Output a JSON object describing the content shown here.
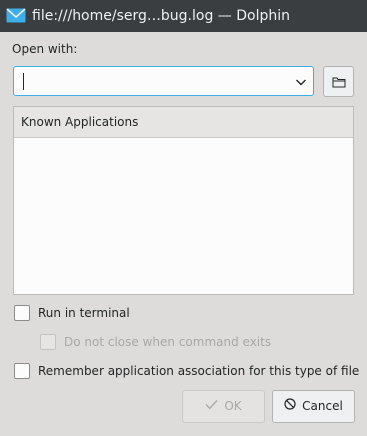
{
  "window": {
    "title": "file:///home/serg…bug.log — Dolphin",
    "icon": "mail-envelope-icon"
  },
  "dialog": {
    "open_with_label": "Open with:",
    "command_input": {
      "value": "",
      "placeholder": ""
    },
    "known_apps_header": "Known Applications",
    "known_apps": [],
    "run_in_terminal": {
      "label": "Run in terminal",
      "checked": false
    },
    "do_not_close": {
      "label": "Do not close when command exits",
      "checked": false,
      "enabled": false
    },
    "remember": {
      "label": "Remember application association for this type of file",
      "checked": false
    },
    "ok_label": "OK",
    "cancel_label": "Cancel"
  },
  "colors": {
    "titlebar": "#3b3e41",
    "background": "#dedcda",
    "focus": "#3daee9"
  }
}
